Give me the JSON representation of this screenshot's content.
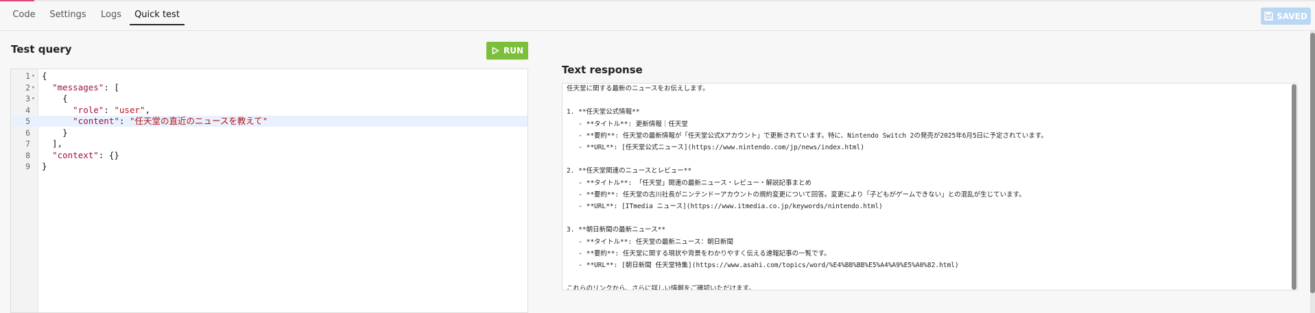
{
  "tabs": [
    {
      "label": "Code",
      "active": false
    },
    {
      "label": "Settings",
      "active": false
    },
    {
      "label": "Logs",
      "active": false
    },
    {
      "label": "Quick test",
      "active": true
    }
  ],
  "header": {
    "saved_label": "SAVED",
    "saved_icon": "floppy-disk-icon"
  },
  "query": {
    "title": "Test query",
    "run_label": "RUN",
    "run_icon": "play-icon",
    "lines": [
      {
        "n": "1",
        "fold": true,
        "text": "{"
      },
      {
        "n": "2",
        "fold": true,
        "text": "  \"messages\": ["
      },
      {
        "n": "3",
        "fold": true,
        "text": "    {"
      },
      {
        "n": "4",
        "fold": false,
        "text": "      \"role\": \"user\","
      },
      {
        "n": "5",
        "fold": false,
        "text": "      \"content\": \"任天堂の直近のニュースを教えて\"",
        "active": true
      },
      {
        "n": "6",
        "fold": false,
        "text": "    }"
      },
      {
        "n": "7",
        "fold": false,
        "text": "  ],"
      },
      {
        "n": "8",
        "fold": false,
        "text": "  \"context\": {}"
      },
      {
        "n": "9",
        "fold": false,
        "text": "}"
      }
    ]
  },
  "response": {
    "title": "Text response",
    "lines": [
      "任天堂に関する最新のニュースをお伝えします。",
      "",
      "1. **任天堂公式情報**",
      "   - **タイトル**: 更新情報｜任天堂",
      "   - **要約**: 任天堂の最新情報が「任天堂公式Xアカウント」で更新されています。特に、Nintendo Switch 2の発売が2025年6月5日に予定されています。",
      "   - **URL**: [任天堂公式ニュース](https://www.nintendo.com/jp/news/index.html)",
      "",
      "2. **任天堂関連のニュースとレビュー**",
      "   - **タイトル**: 「任天堂」関連の最新ニュース・レビュー・解説記事まとめ",
      "   - **要約**: 任天堂の古川社長がニンテンドーアカウントの規約変更について回答。変更により「子どもがゲームできない」との混乱が生じています。",
      "   - **URL**: [ITmedia ニュース](https://www.itmedia.co.jp/keywords/nintendo.html)",
      "",
      "3. **朝日新聞の最新ニュース**",
      "   - **タイトル**: 任天堂の最新ニュース：朝日新聞",
      "   - **要約**: 任天堂に関する現状や背景をわかりやすく伝える速報記事の一覧です。",
      "   - **URL**: [朝日新聞 任天堂特集](https://www.asahi.com/topics/word/%E4%BB%BB%E5%A4%A9%E5%A0%82.html)",
      "",
      "これらのリンクから、さらに詳しい情報をご確認いただけます。"
    ]
  }
}
